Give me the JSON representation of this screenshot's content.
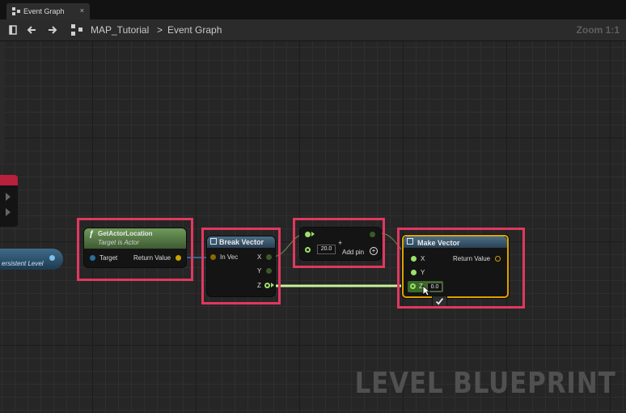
{
  "tab": {
    "title": "Event Graph",
    "close": "×"
  },
  "breadcrumb": {
    "level": "MAP_Tutorial",
    "separator": ">",
    "graph": "Event Graph"
  },
  "zoom": "Zoom 1:1",
  "persistent_level": "ersistent Level",
  "nodes": {
    "get_actor_location": {
      "title": "GetActorLocation",
      "subtitle": "Target is Actor",
      "target": "Target",
      "return_value": "Return Value"
    },
    "break_vector": {
      "title": "Break Vector",
      "in_vec": "In Vec",
      "x": "X",
      "y": "Y",
      "z": "Z"
    },
    "add": {
      "operator": "+",
      "value": "20.0",
      "add_pin": "Add pin"
    },
    "make_vector": {
      "title": "Make Vector",
      "x": "X",
      "y": "Y",
      "z": "Z",
      "return_value": "Return Value",
      "z_value": "0.0"
    }
  },
  "watermark": "LEVEL BLUEPRINT",
  "colors": {
    "highlight": "#e0385f",
    "exec_wire": "#c8f29a",
    "float_pin": "#9ce06b",
    "selected_border": "#e0a000"
  }
}
